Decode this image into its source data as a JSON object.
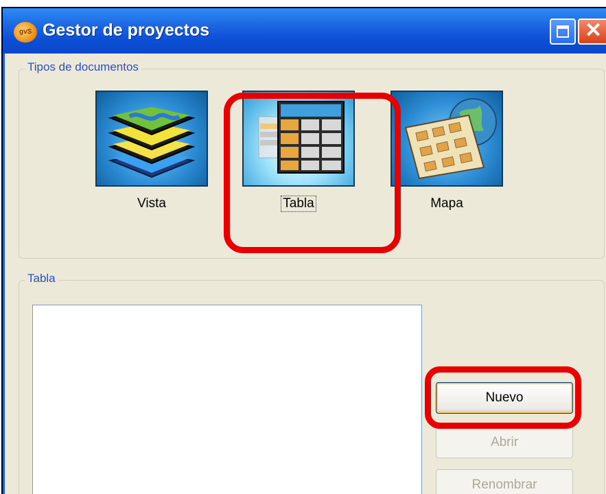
{
  "window": {
    "title": "Gestor de proyectos",
    "controls": {
      "maximize_icon": "maximize-icon",
      "close_icon": "close-icon"
    }
  },
  "document_types": {
    "legend": "Tipos de documentos",
    "items": [
      {
        "label": "Vista",
        "icon": "layers-icon",
        "selected": false
      },
      {
        "label": "Tabla",
        "icon": "table-icon",
        "selected": true
      },
      {
        "label": "Mapa",
        "icon": "map-icon",
        "selected": false
      }
    ]
  },
  "documents": {
    "legend": "Tabla",
    "items": [],
    "buttons": {
      "new": {
        "label": "Nuevo",
        "enabled": true
      },
      "open": {
        "label": "Abrir",
        "enabled": false
      },
      "rename": {
        "label": "Renombrar",
        "enabled": false
      }
    }
  },
  "colors": {
    "titlebar": "#0a47c8",
    "highlight": "#e80000",
    "legend_text": "#2a4fc8",
    "window_bg": "#ece9d8"
  }
}
